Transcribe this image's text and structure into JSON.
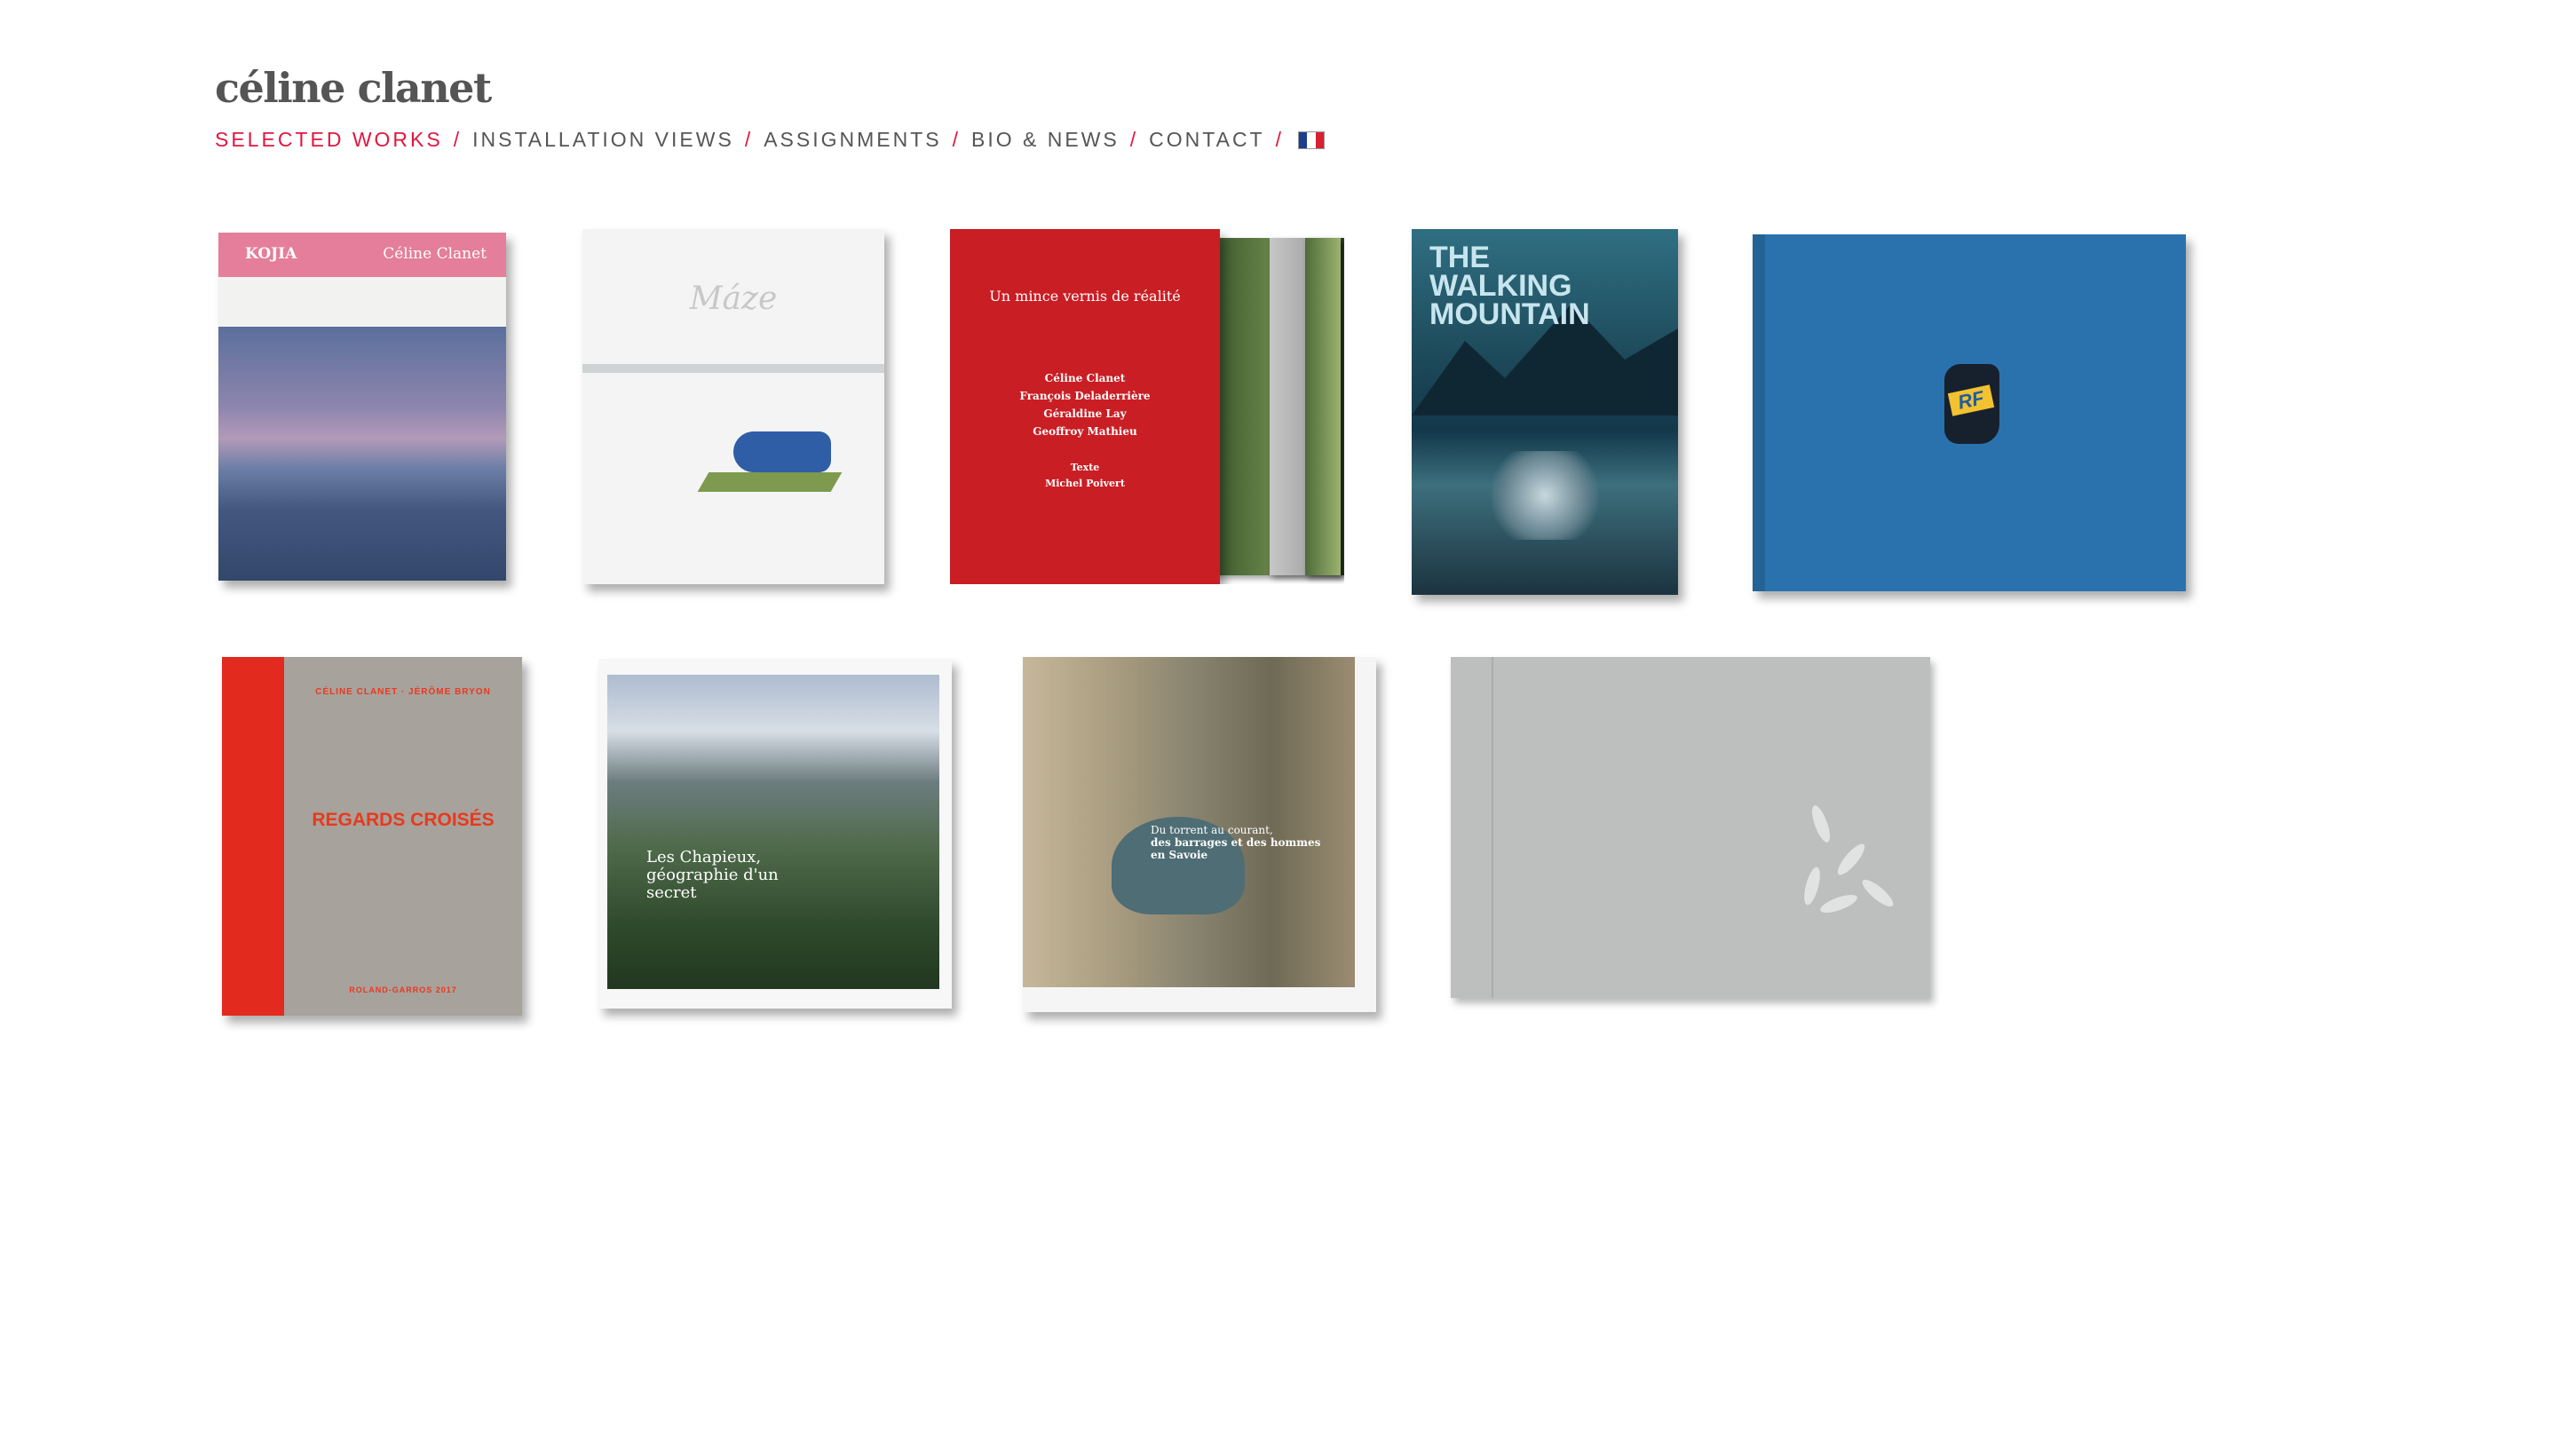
{
  "site": {
    "title": "céline clanet"
  },
  "nav": {
    "items": [
      {
        "label": "SELECTED WORKS",
        "active": true
      },
      {
        "label": "INSTALLATION VIEWS",
        "active": false
      },
      {
        "label": "ASSIGNMENTS",
        "active": false
      },
      {
        "label": "BIO & NEWS",
        "active": false
      },
      {
        "label": "CONTACT",
        "active": false
      }
    ],
    "separator": "/",
    "accent_color": "#e0173f",
    "text_color": "#555555",
    "language_flag": "french-flag-icon"
  },
  "books": {
    "kojia": {
      "title": "KOJIA",
      "author": "Céline Clanet"
    },
    "maze": {
      "title": "Máze"
    },
    "mince": {
      "title": "Un mince vernis de réalité",
      "authors": [
        "Céline Clanet",
        "François Deladerrière",
        "Géraldine Lay",
        "Geoffroy Mathieu"
      ],
      "intro_label": "Texte",
      "intro_author": "Michel Poivert"
    },
    "walking_mountain": {
      "title": "THE WALKING MOUNTAIN"
    },
    "rf": {
      "badge": "RF"
    },
    "regards": {
      "authors": "CÉLINE CLANET · JÉRÔME BRYON",
      "title": "REGARDS CROISÉS",
      "footer": "ROLAND-GARROS 2017"
    },
    "chapieux": {
      "title": "Les Chapieux, géographie d'un secret"
    },
    "torrent": {
      "title_line1": "Du torrent au courant,",
      "title_line2": "des barrages et des hommes en Savoie"
    },
    "linen": {}
  }
}
